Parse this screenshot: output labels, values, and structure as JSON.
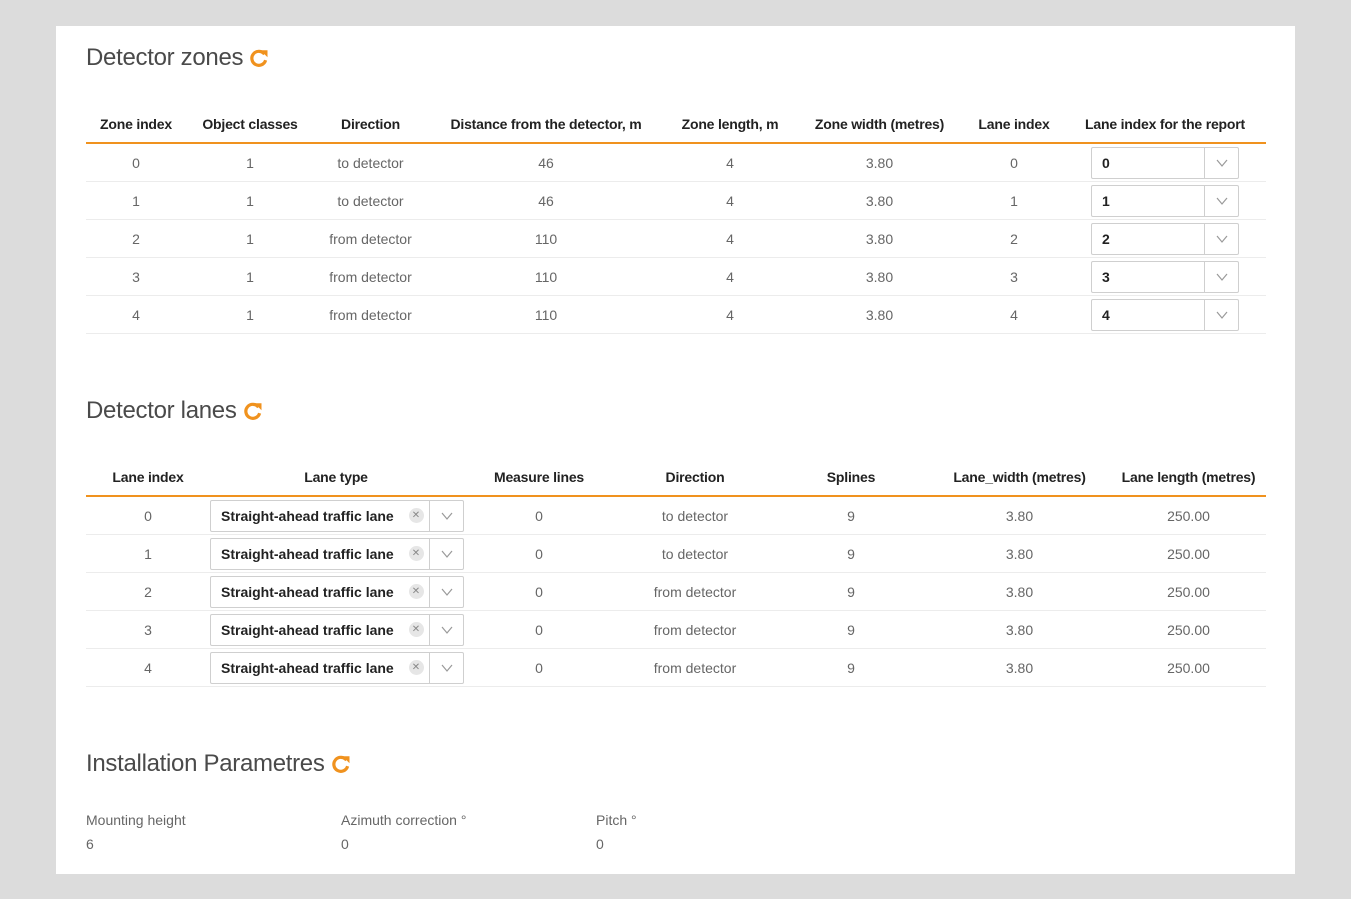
{
  "zones": {
    "title": "Detector zones",
    "headers": [
      "Zone index",
      "Object classes",
      "Direction",
      "Distance from the detector, m",
      "Zone length, m",
      "Zone width (metres)",
      "Lane index",
      "Lane index for the report"
    ],
    "rows": [
      {
        "zone_index": "0",
        "object_classes": "1",
        "direction": "to detector",
        "distance": "46",
        "zone_length": "4",
        "zone_width": "3.80",
        "lane_index": "0",
        "report_lane": "0"
      },
      {
        "zone_index": "1",
        "object_classes": "1",
        "direction": "to detector",
        "distance": "46",
        "zone_length": "4",
        "zone_width": "3.80",
        "lane_index": "1",
        "report_lane": "1"
      },
      {
        "zone_index": "2",
        "object_classes": "1",
        "direction": "from detector",
        "distance": "110",
        "zone_length": "4",
        "zone_width": "3.80",
        "lane_index": "2",
        "report_lane": "2"
      },
      {
        "zone_index": "3",
        "object_classes": "1",
        "direction": "from detector",
        "distance": "110",
        "zone_length": "4",
        "zone_width": "3.80",
        "lane_index": "3",
        "report_lane": "3"
      },
      {
        "zone_index": "4",
        "object_classes": "1",
        "direction": "from detector",
        "distance": "110",
        "zone_length": "4",
        "zone_width": "3.80",
        "lane_index": "4",
        "report_lane": "4"
      }
    ]
  },
  "lanes": {
    "title": "Detector lanes",
    "headers": [
      "Lane index",
      "Lane type",
      "Measure lines",
      "Direction",
      "Splines",
      "Lane_width (metres)",
      "Lane length (metres)"
    ],
    "rows": [
      {
        "lane_index": "0",
        "lane_type": "Straight-ahead traffic lane",
        "measure_lines": "0",
        "direction": "to detector",
        "splines": "9",
        "lane_width": "3.80",
        "lane_length": "250.00"
      },
      {
        "lane_index": "1",
        "lane_type": "Straight-ahead traffic lane",
        "measure_lines": "0",
        "direction": "to detector",
        "splines": "9",
        "lane_width": "3.80",
        "lane_length": "250.00"
      },
      {
        "lane_index": "2",
        "lane_type": "Straight-ahead traffic lane",
        "measure_lines": "0",
        "direction": "from detector",
        "splines": "9",
        "lane_width": "3.80",
        "lane_length": "250.00"
      },
      {
        "lane_index": "3",
        "lane_type": "Straight-ahead traffic lane",
        "measure_lines": "0",
        "direction": "from detector",
        "splines": "9",
        "lane_width": "3.80",
        "lane_length": "250.00"
      },
      {
        "lane_index": "4",
        "lane_type": "Straight-ahead traffic lane",
        "measure_lines": "0",
        "direction": "from detector",
        "splines": "9",
        "lane_width": "3.80",
        "lane_length": "250.00"
      }
    ]
  },
  "installation": {
    "title": "Installation Parametres",
    "params": [
      {
        "label": "Mounting height",
        "value": "6"
      },
      {
        "label": "Azimuth correction °",
        "value": "0"
      },
      {
        "label": "Pitch °",
        "value": "0"
      }
    ]
  },
  "icons": {
    "refresh": "refresh-icon",
    "dropdown": "chevron-down-icon",
    "clear": "clear-icon"
  },
  "colors": {
    "accent": "#f0921e",
    "background": "#dcdcdc",
    "card": "#ffffff"
  }
}
